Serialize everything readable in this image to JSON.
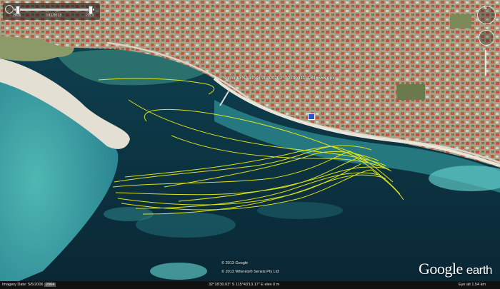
{
  "map": {
    "place_label": "Sorrento SAILING 20200201_20130311_1846556.gpx",
    "copyright_lines": [
      "© 2013 Google",
      "© 2013 Whereis® Sensis Pty Ltd"
    ]
  },
  "time_slider": {
    "start_date": "2005",
    "current_date": "3/11/2013",
    "end_date": "2013"
  },
  "nav": {
    "north_label": "N"
  },
  "logo": {
    "google": "Google",
    "earth": "earth"
  },
  "status_bar": {
    "imagery_date": "Imagery Date: 5/5/2006",
    "year": "2004",
    "coordinates": "32°18'30.03\" S  115°43'13.17\" E  elev     0 m",
    "eye_alt": "Eye alt    1.54 km"
  },
  "colors": {
    "track": "#e6ec19",
    "deep_water": "#0f3a4a",
    "shallow_water": "#3c9ea4",
    "land": "#b9b19c"
  }
}
